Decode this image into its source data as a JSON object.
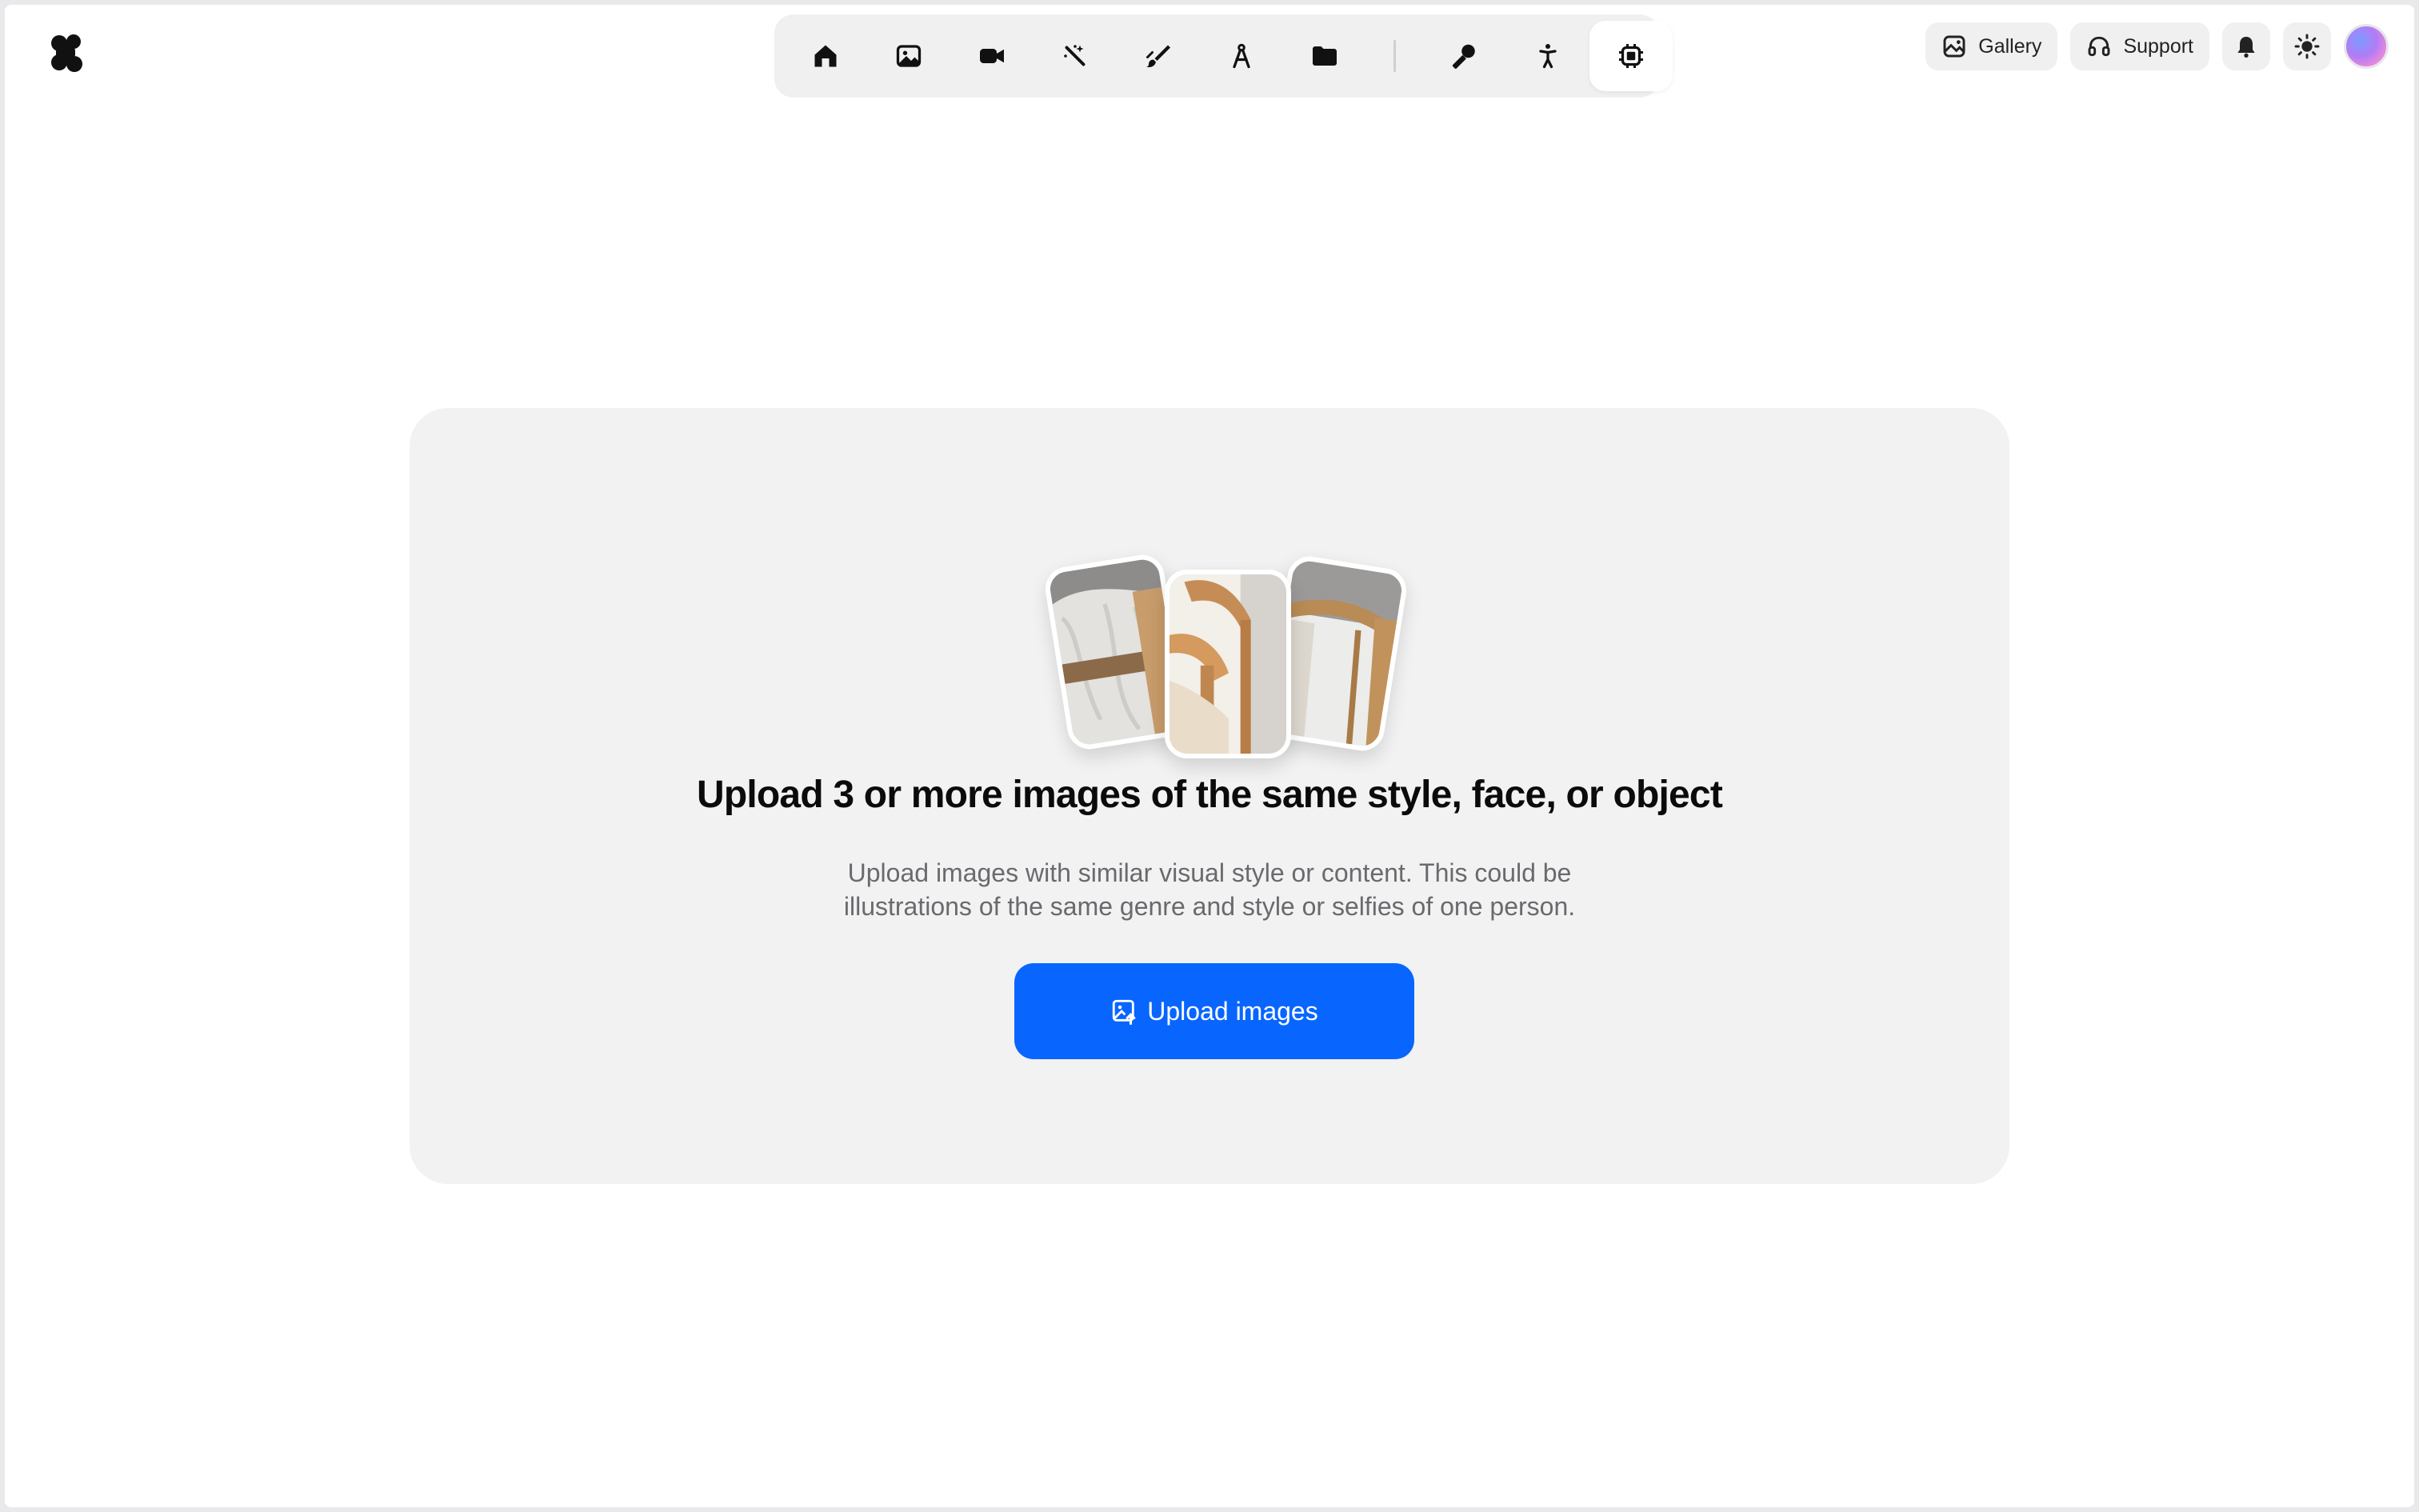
{
  "header": {
    "logo_icon": "krea-logo-icon",
    "toolbar": [
      {
        "name": "home",
        "icon": "home-icon",
        "active": false
      },
      {
        "name": "image",
        "icon": "image-icon",
        "active": false
      },
      {
        "name": "video",
        "icon": "video-camera-icon",
        "active": false
      },
      {
        "name": "enhance",
        "icon": "magic-wand-icon",
        "active": false
      },
      {
        "name": "edit",
        "icon": "brush-icon",
        "active": false
      },
      {
        "name": "design",
        "icon": "compass-icon",
        "active": false
      },
      {
        "name": "assets",
        "icon": "folder-icon",
        "active": false
      },
      {
        "name": "voice",
        "icon": "microphone-icon",
        "active": false
      },
      {
        "name": "motion",
        "icon": "figure-icon",
        "active": false
      },
      {
        "name": "train",
        "icon": "chip-icon",
        "active": true
      }
    ],
    "gallery_label": "Gallery",
    "support_label": "Support",
    "notifications_icon": "bell-icon",
    "theme_icon": "sun-icon"
  },
  "main": {
    "title": "Upload 3 or more images of the same style, face, or object",
    "subtitle": "Upload images with similar visual style or content. This could be illustrations of the same genre and style or selfies of one person.",
    "upload_button_label": "Upload images"
  },
  "colors": {
    "accent": "#0866ff",
    "card_background": "#f2f2f3",
    "toolbar_background": "#f0f0f1"
  }
}
